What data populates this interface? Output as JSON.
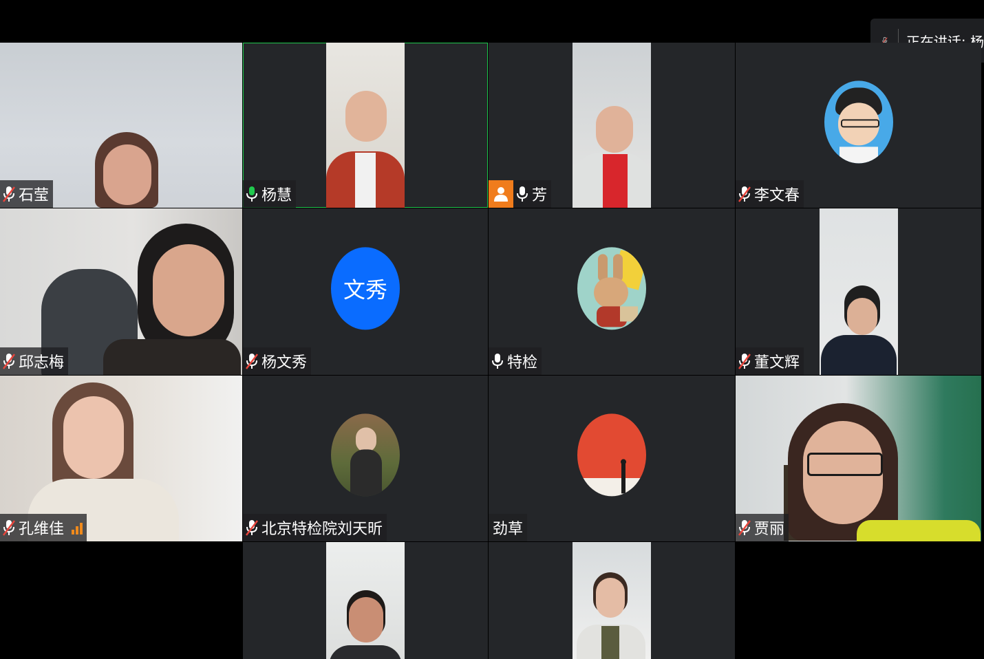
{
  "speaking_indicator": {
    "label": "正在讲话: 杨"
  },
  "participants": [
    {
      "id": "shiying",
      "name": "石莹",
      "mic": "muted",
      "kind": "video-full"
    },
    {
      "id": "yanghui",
      "name": "杨慧",
      "mic": "active",
      "kind": "video",
      "active_speaker": true
    },
    {
      "id": "fang",
      "name": "芳",
      "mic": "on",
      "kind": "video",
      "host": true
    },
    {
      "id": "liwenchun",
      "name": "李文春",
      "mic": "muted",
      "kind": "avatar-cartoon"
    },
    {
      "id": "qiuzhimei",
      "name": "邱志梅",
      "mic": "muted",
      "kind": "video-full"
    },
    {
      "id": "yangwenxiu",
      "name": "杨文秀",
      "mic": "muted",
      "kind": "avatar-text",
      "avatar_text": "文秀"
    },
    {
      "id": "tejian",
      "name": "特检",
      "mic": "on",
      "kind": "avatar-rabbit"
    },
    {
      "id": "dongwenhui",
      "name": "董文辉",
      "mic": "muted",
      "kind": "video"
    },
    {
      "id": "kongweijia",
      "name": "孔维佳",
      "mic": "muted",
      "kind": "video-full",
      "signal": true
    },
    {
      "id": "liutianxin",
      "name": "北京特检院刘天昕",
      "mic": "muted",
      "kind": "avatar-photo"
    },
    {
      "id": "jincao",
      "name": "劲草",
      "mic": "none",
      "kind": "avatar-red"
    },
    {
      "id": "jiali",
      "name": "贾丽",
      "mic": "muted",
      "kind": "video-full"
    }
  ],
  "colors": {
    "active_border": "#1fc84e",
    "host_badge": "#f07c1c",
    "avatar_blue": "#0a6cff",
    "tile_bg": "#242629"
  }
}
